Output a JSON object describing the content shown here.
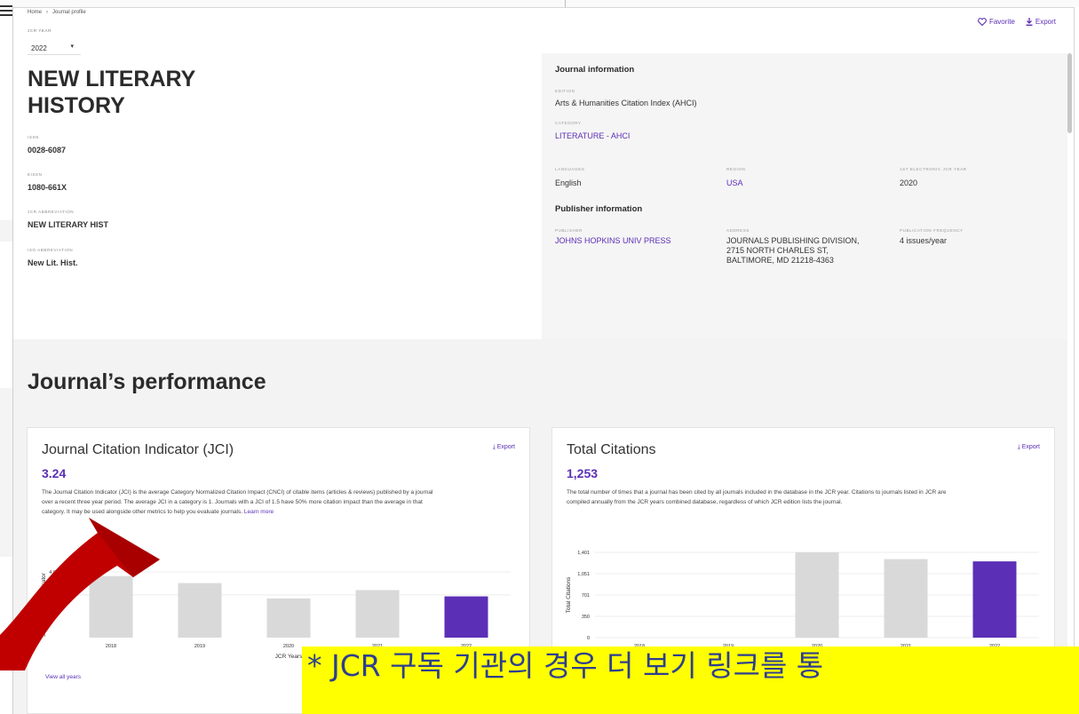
{
  "breadcrumb": {
    "home": "Home",
    "current": "Journal profile"
  },
  "jcr_year": {
    "label": "JCR YEAR",
    "value": "2022"
  },
  "actions": {
    "favorite": "Favorite",
    "export": "Export"
  },
  "journal": {
    "title": "NEW LITERARY HISTORY",
    "issn_label": "ISSN",
    "issn": "0028-6087",
    "eissn_label": "EISSN",
    "eissn": "1080-661X",
    "jcr_abbrev_label": "JCR ABBREVIATION",
    "jcr_abbrev": "NEW LITERARY HIST",
    "iso_abbrev_label": "ISO ABBREVIATION",
    "iso_abbrev": "New Lit. Hist."
  },
  "journal_info": {
    "heading": "Journal information",
    "edition_label": "EDITION",
    "edition": "Arts & Humanities Citation Index (AHCI)",
    "category_label": "CATEGORY",
    "category": "LITERATURE - AHCI",
    "languages_label": "LANGUAGES",
    "languages": "English",
    "region_label": "REGION",
    "region": "USA",
    "first_year_label": "1ST ELECTRONIC JCR YEAR",
    "first_year": "2020"
  },
  "publisher_info": {
    "heading": "Publisher information",
    "publisher_label": "PUBLISHER",
    "publisher": "JOHNS HOPKINS UNIV PRESS",
    "address_label": "ADDRESS",
    "address_line1": "JOURNALS PUBLISHING DIVISION,",
    "address_line2": "2715 NORTH CHARLES ST,",
    "address_line3": "BALTIMORE, MD 21218-4363",
    "frequency_label": "PUBLICATION FREQUENCY",
    "frequency": "4 issues/year"
  },
  "performance": {
    "heading": "Journal’s performance"
  },
  "jci_card": {
    "title": "Journal Citation Indicator (JCI)",
    "export": "Export",
    "value": "3.24",
    "desc_line1": "The Journal Citation Indicator (JCI) is the average Category Normalized Citation Impact (CNCI) of citable items (articles & reviews) published by a journal",
    "desc_line2": "over a recent three year period. The average JCI in a category is 1. Journals with a JCI of 1.5 have 50% more citation impact than the average in that",
    "desc_line3": "category. It may be used alongside other metrics to help you evaluate journals.",
    "learn_more": "Learn more",
    "view_all": "View all years"
  },
  "tc_card": {
    "title": "Total Citations",
    "export": "Export",
    "value": "1,253",
    "desc_line1": "The total number of times that a journal has been cited by all journals included in the database in the JCR year. Citations to journals listed in JCR are",
    "desc_line2": "compiled annually from the JCR years combined database, regardless of which JCR edition lists the journal."
  },
  "overlay": {
    "text": "* JCR 구독 기관의 경우 더 보기 링크를 통"
  },
  "colors": {
    "accent": "#5b2fb6",
    "bar_grey": "#d9d9d9",
    "arrow_red": "#c00000",
    "note_bg": "#ffff00"
  },
  "chart_data": [
    {
      "type": "bar",
      "categories": [
        "2018",
        "2019",
        "2020",
        "2021",
        "2022"
      ],
      "values": [
        4.4,
        3.9,
        2.8,
        3.4,
        2.95
      ],
      "highlight_index": 4,
      "xlabel": "JCR Years",
      "ylabel": "Journal Citation Indicator",
      "yticks": [
        "4.040",
        "3."
      ],
      "ylim": [
        0,
        4.7
      ]
    },
    {
      "type": "bar",
      "categories": [
        "2018",
        "2019",
        "2020",
        "2021",
        "2022"
      ],
      "values": [
        0,
        0,
        1401,
        1290,
        1253
      ],
      "highlight_index": 4,
      "xlabel": "JCR Years",
      "ylabel": "Total Citations",
      "yticks": [
        "1,401",
        "1,051",
        "701",
        "350",
        "0"
      ],
      "ylim": [
        0,
        1401
      ]
    }
  ]
}
